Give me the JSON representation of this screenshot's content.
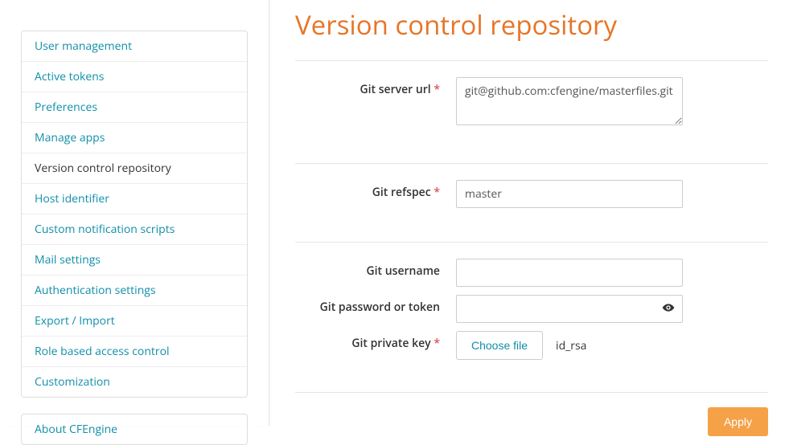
{
  "sidebar": {
    "items": [
      {
        "label": "User management",
        "active": false
      },
      {
        "label": "Active tokens",
        "active": false
      },
      {
        "label": "Preferences",
        "active": false
      },
      {
        "label": "Manage apps",
        "active": false
      },
      {
        "label": "Version control repository",
        "active": true
      },
      {
        "label": "Host identifier",
        "active": false
      },
      {
        "label": "Custom notification scripts",
        "active": false
      },
      {
        "label": "Mail settings",
        "active": false
      },
      {
        "label": "Authentication settings",
        "active": false
      },
      {
        "label": "Export / Import",
        "active": false
      },
      {
        "label": "Role based access control",
        "active": false
      },
      {
        "label": "Customization",
        "active": false
      }
    ],
    "about_label": "About CFEngine"
  },
  "page": {
    "title": "Version control repository"
  },
  "form": {
    "git_server_url": {
      "label": "Git server url",
      "required": true,
      "value": "git@github.com:cfengine/masterfiles.git"
    },
    "git_refspec": {
      "label": "Git refspec",
      "required": true,
      "value": "master"
    },
    "git_username": {
      "label": "Git username",
      "required": false,
      "value": ""
    },
    "git_password": {
      "label": "Git password or token",
      "required": false,
      "value": ""
    },
    "git_private_key": {
      "label": "Git private key",
      "required": true,
      "button": "Choose file",
      "filename": "id_rsa"
    },
    "apply_label": "Apply",
    "required_marker": "*"
  }
}
